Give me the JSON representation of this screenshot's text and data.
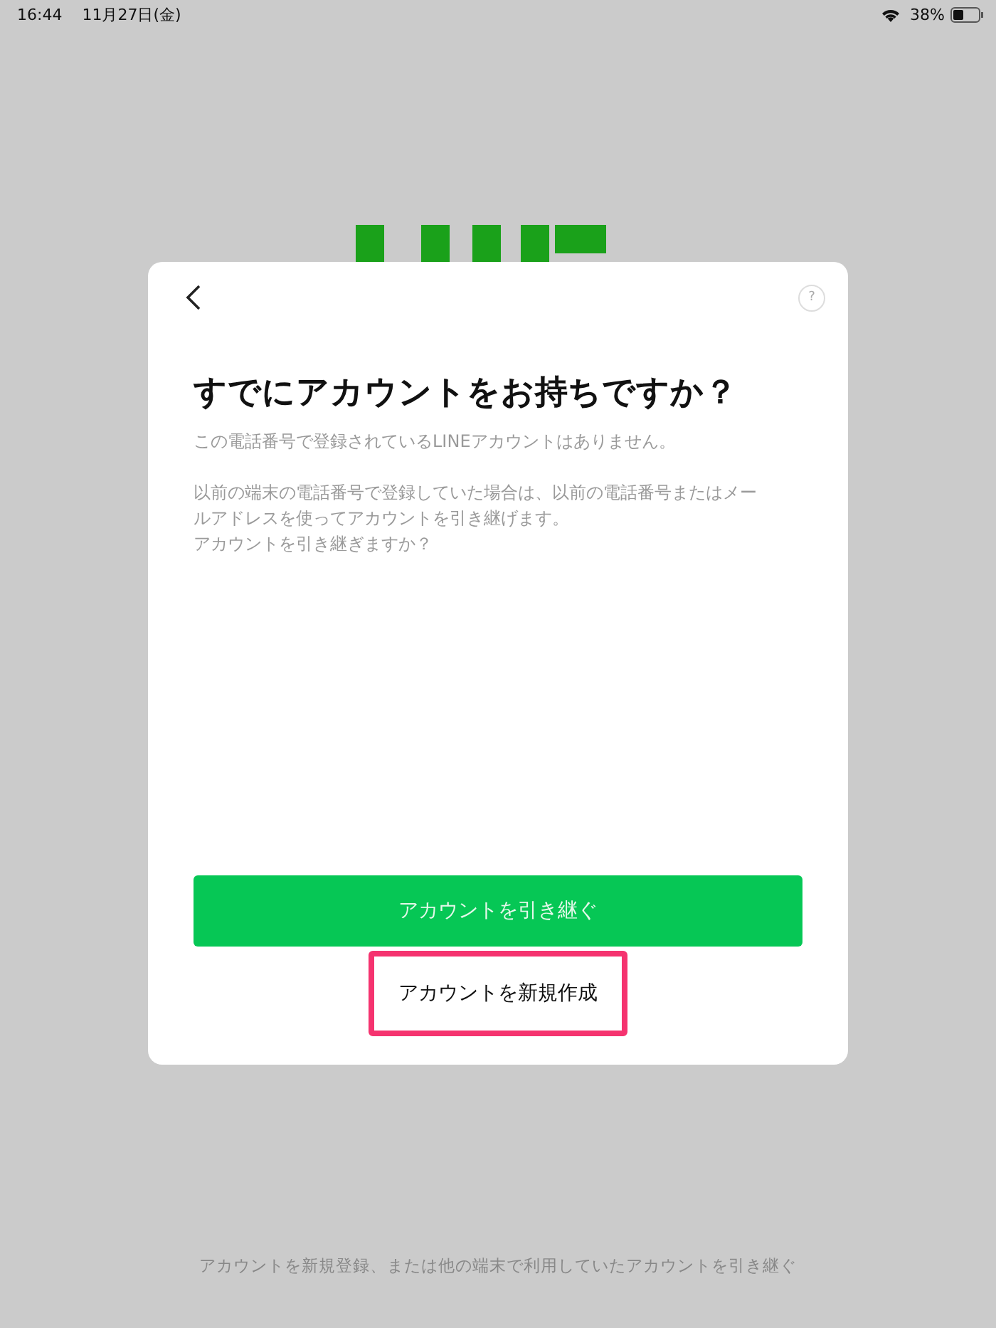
{
  "status_bar": {
    "time": "16:44",
    "date": "11月27日(金)",
    "battery": "38%"
  },
  "dialog": {
    "help_button": "?",
    "title": "すでにアカウントをお持ちですか？",
    "paragraphs": [
      "この電話番号で登録されているLINEアカウントはありません。",
      "以前の端末の電話番号で登録していた場合は、以前の電話番号またはメールアドレスを使ってアカウントを引き継げます。",
      "アカウントを引き継ぎますか？"
    ],
    "primary_button": "アカウントを引き継ぐ",
    "secondary_button": {
      "label": "アカウントを新規作成",
      "highlighted": true
    }
  },
  "footer": "アカウントを新規登録、または他の端末で利用していたアカウントを引き継ぐ"
}
